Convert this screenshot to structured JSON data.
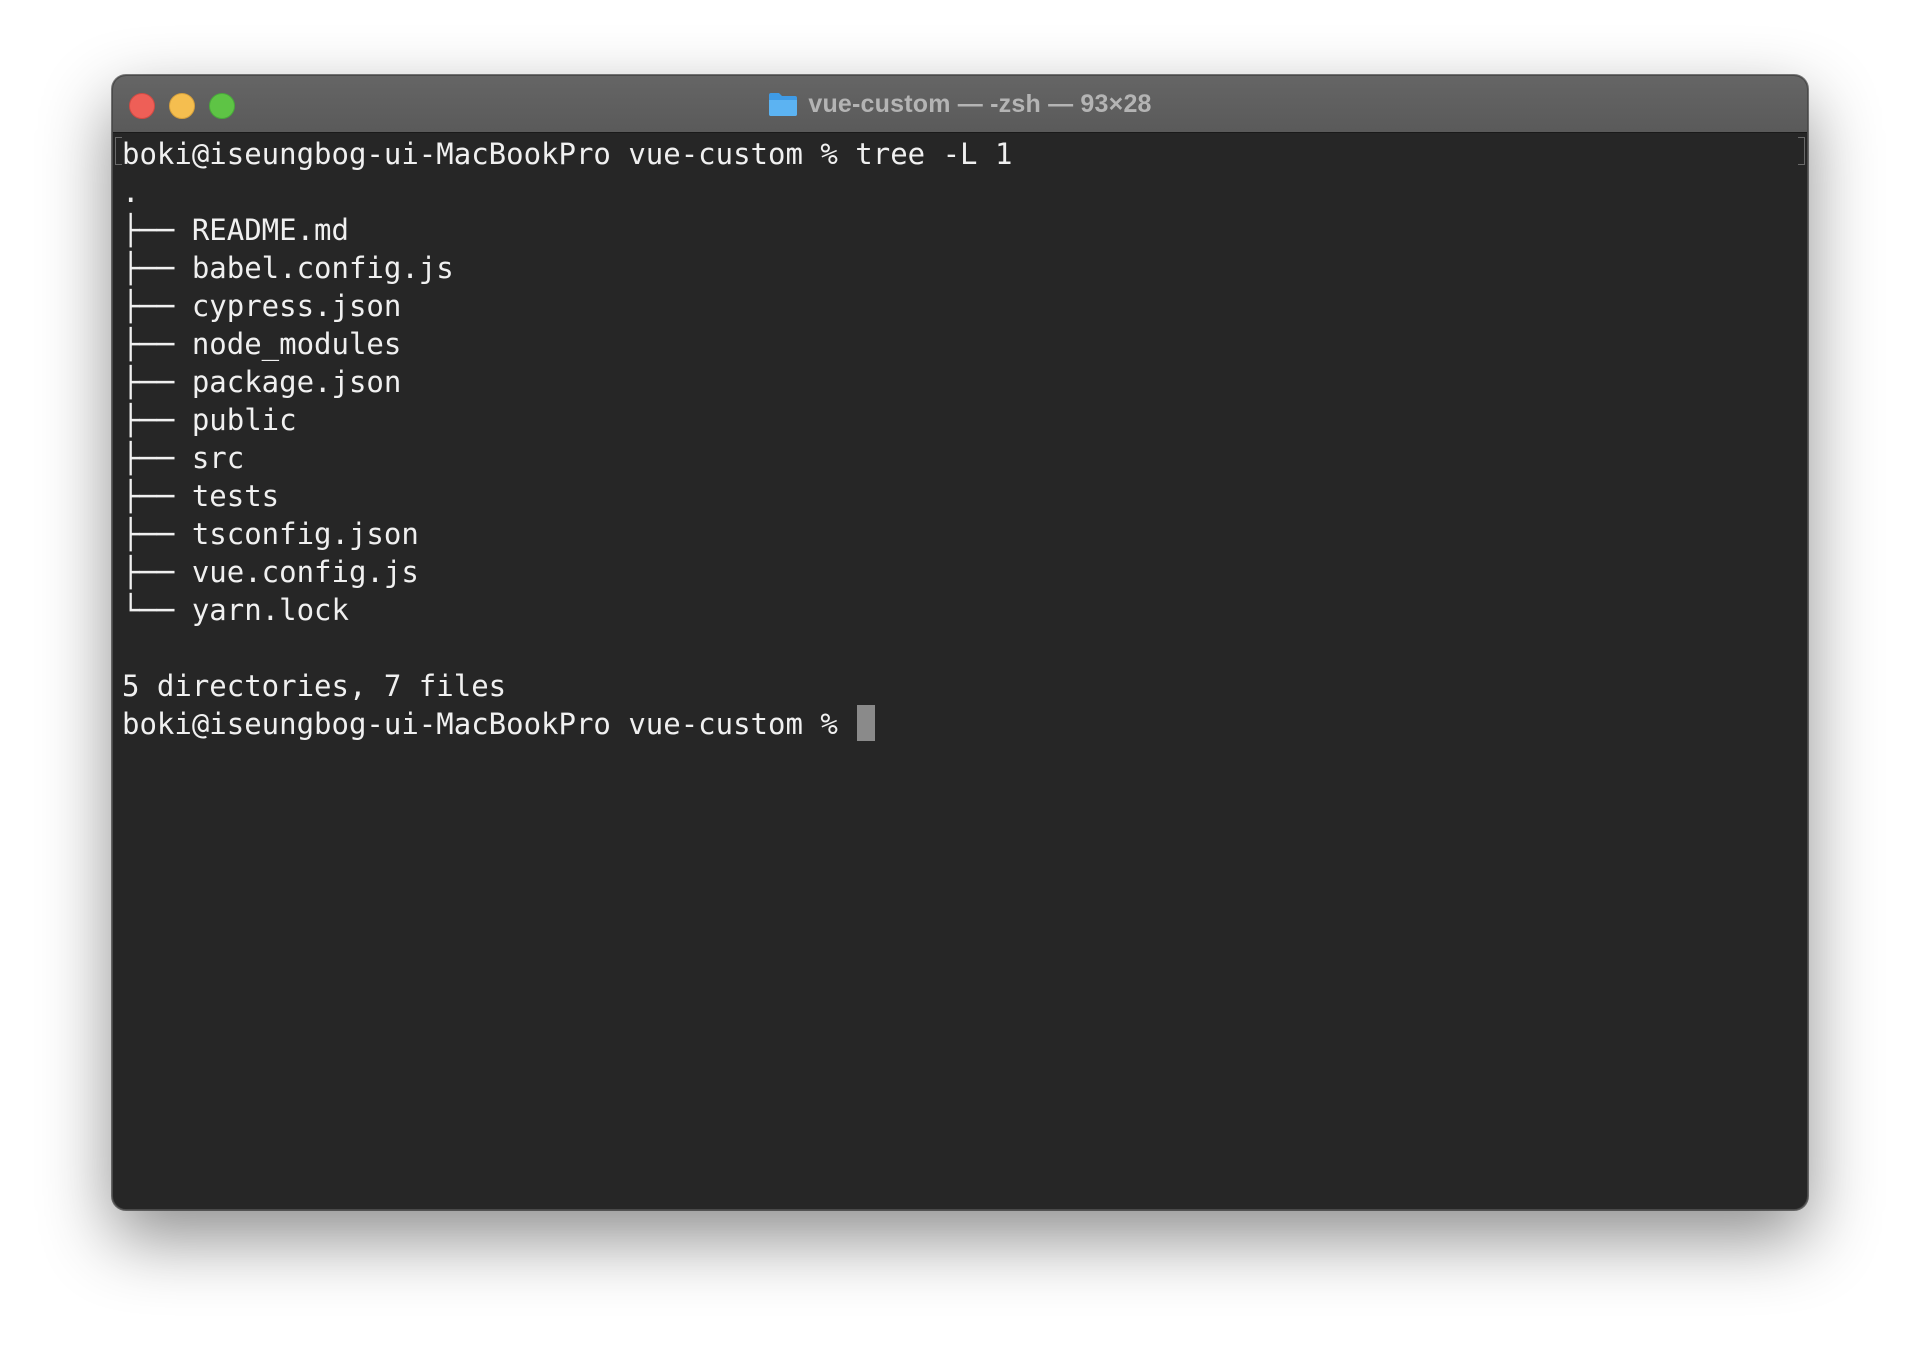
{
  "window": {
    "title": "vue-custom — -zsh — 93×28",
    "colors": {
      "close": "#ee5f57",
      "minimize": "#f5be4f",
      "zoom": "#5ec445",
      "background": "#262626",
      "text": "#f0f0f0"
    }
  },
  "terminal": {
    "lines": [
      "boki@iseungbog-ui-MacBookPro vue-custom % tree -L 1",
      ".",
      "├── README.md",
      "├── babel.config.js",
      "├── cypress.json",
      "├── node_modules",
      "├── package.json",
      "├── public",
      "├── src",
      "├── tests",
      "├── tsconfig.json",
      "├── vue.config.js",
      "└── yarn.lock",
      "",
      "5 directories, 7 files"
    ],
    "prompt": "boki@iseungbog-ui-MacBookPro vue-custom % "
  }
}
